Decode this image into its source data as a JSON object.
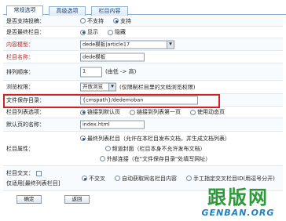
{
  "tabs": [
    "常规选项",
    "高级选项",
    "栏目内容"
  ],
  "fields": {
    "submit": {
      "label": "是否支持投稿：",
      "options": [
        "不支持",
        "支持"
      ],
      "selected": 1
    },
    "final": {
      "label": "是否最终栏目：",
      "options": [
        "显示",
        "隐藏"
      ],
      "selected": 0
    },
    "model": {
      "label": "内容模型：",
      "value": "dede模板|article17"
    },
    "name": {
      "label": "栏目名称：",
      "value": "dede模板"
    },
    "order": {
      "label": "排列顺序：",
      "value": "1",
      "hint": "(由低 -> 高)"
    },
    "perm": {
      "label": "浏览权限：",
      "value": "开放浏览",
      "hint": "(仅限制栏目里的文档浏览权限)"
    },
    "dir": {
      "label": "文件保存目录：",
      "value": "{cmspath}/dedemoban"
    },
    "listopt": {
      "label": "栏目列表选项：",
      "options": [
        "链接到默认页",
        "链接到列表第一页",
        "使用动态页"
      ],
      "selected": 0
    },
    "defpage": {
      "label": "默认页的名称：",
      "value": "index.html"
    },
    "attr": {
      "label": "栏目属性：",
      "options": [
        "最终列表栏目（允许在本栏目发布文档，并生成文档列表）",
        "频道封面（栏目本身不允许发布文档）",
        "外部连接（在\"文件保存目录\"处填写网址）"
      ],
      "selected": 0
    },
    "cross": {
      "label": "栏目交叉：",
      "note": "仅适用[最终列表栏目]",
      "options": [
        "不交叉",
        "自动获取同名栏目内容",
        "手工指定交叉栏目ID(用逗号分开)"
      ],
      "selected": 0
    }
  },
  "buttons": {
    "ok": "确定",
    "back": "返回"
  },
  "watermark": {
    "cn": "跟版网",
    "en": "GENBAN.ORG"
  }
}
